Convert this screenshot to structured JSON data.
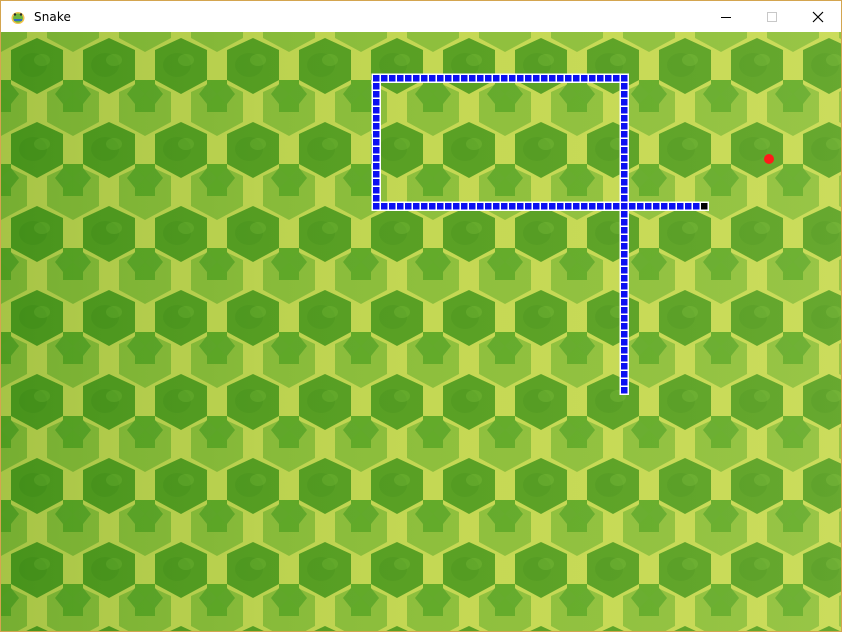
{
  "window": {
    "title": "Snake"
  },
  "titlebar": {
    "icons": {
      "app": "python-snake-icon",
      "minimize": "minimize-icon",
      "maximize": "maximize-icon",
      "close": "close-icon"
    }
  },
  "game": {
    "grid_cell": 8,
    "colors": {
      "snake_body": "#0b10f2",
      "snake_body_border": "#ffffff",
      "snake_head": "#000000",
      "food": "#ff1a1a",
      "background_cell": "#4e9a1f",
      "background_mesh": "#c9de5a"
    },
    "snake": {
      "head": [
        87,
        21
      ],
      "path": [
        [
          87,
          21
        ],
        [
          46,
          21
        ],
        [
          46,
          5
        ],
        [
          77,
          5
        ],
        [
          77,
          44
        ]
      ]
    },
    "food": [
      95,
      15
    ]
  }
}
